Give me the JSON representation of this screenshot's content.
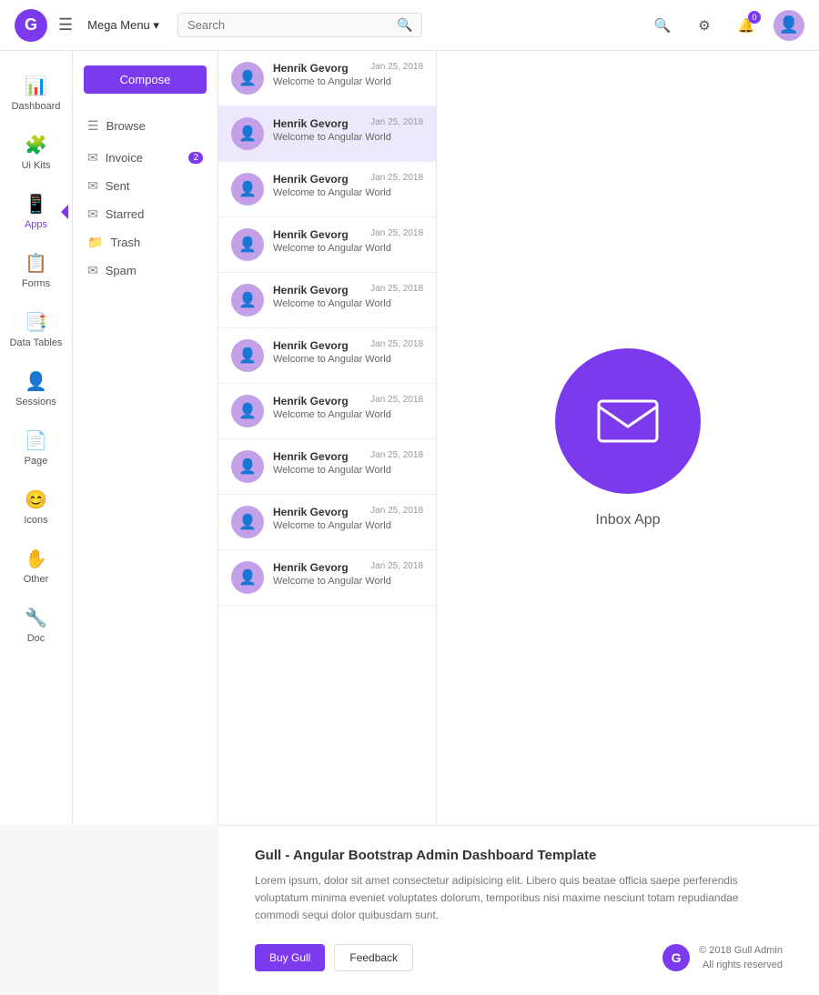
{
  "navbar": {
    "logo": "G",
    "menu_icon": "☰",
    "mega_menu_label": "Mega Menu ▾",
    "search_placeholder": "Search",
    "search_icon": "🔍",
    "icons": {
      "search": "🔍",
      "settings": "⚙",
      "notifications": "🔔",
      "notification_badge": "0",
      "avatar": "👤"
    }
  },
  "sidebar": {
    "items": [
      {
        "id": "dashboard",
        "label": "Dashboard",
        "icon": "📊"
      },
      {
        "id": "ui-kits",
        "label": "Ui Kits",
        "icon": "🧩"
      },
      {
        "id": "apps",
        "label": "Apps",
        "icon": "📱",
        "active": true
      },
      {
        "id": "forms",
        "label": "Forms",
        "icon": "📋"
      },
      {
        "id": "data-tables",
        "label": "Data Tables",
        "icon": "📑"
      },
      {
        "id": "sessions",
        "label": "Sessions",
        "icon": "👤"
      },
      {
        "id": "page",
        "label": "Page",
        "icon": "📄"
      },
      {
        "id": "icons",
        "label": "Icons",
        "icon": "😊"
      },
      {
        "id": "other",
        "label": "Other",
        "icon": "✋"
      },
      {
        "id": "doc",
        "label": "Doc",
        "icon": "🔧"
      }
    ]
  },
  "second_sidebar": {
    "compose_label": "Compose",
    "browse_label": "Browse",
    "items": [
      {
        "id": "inbox",
        "label": "Invoice",
        "badge": "2",
        "icon": "✉"
      },
      {
        "id": "sent",
        "label": "Sent",
        "icon": "✉"
      },
      {
        "id": "starred",
        "label": "Starred",
        "icon": "✉"
      },
      {
        "id": "trash",
        "label": "Trash",
        "icon": "📁"
      },
      {
        "id": "spam",
        "label": "Spam",
        "icon": "✉"
      }
    ]
  },
  "emails": [
    {
      "sender": "Henrik Gevorg",
      "date": "Jan 25, 2018",
      "subject": "Welcome to Angular World",
      "active": false
    },
    {
      "sender": "Henrik Gevorg",
      "date": "Jan 25, 2018",
      "subject": "Welcome to Angular World",
      "active": true
    },
    {
      "sender": "Henrik Gevorg",
      "date": "Jan 25, 2018",
      "subject": "Welcome to Angular World",
      "active": false
    },
    {
      "sender": "Henrik Gevorg",
      "date": "Jan 25, 2018",
      "subject": "Welcome to Angular World",
      "active": false
    },
    {
      "sender": "Henrik Gevorg",
      "date": "Jan 25, 2018",
      "subject": "Welcome to Angular World",
      "active": false
    },
    {
      "sender": "Henrik Gevorg",
      "date": "Jan 25, 2018",
      "subject": "Welcome to Angular World",
      "active": false
    },
    {
      "sender": "Henrik Gevorg",
      "date": "Jan 25, 2018",
      "subject": "Welcome to Angular World",
      "active": false
    },
    {
      "sender": "Henrik Gevorg",
      "date": "Jan 25, 2018",
      "subject": "Welcome to Angular World",
      "active": false
    },
    {
      "sender": "Henrik Gevorg",
      "date": "Jan 25, 2018",
      "subject": "Welcome to Angular World",
      "active": false
    },
    {
      "sender": "Henrik Gevorg",
      "date": "Jan 25, 2018",
      "subject": "Welcome to Angular World",
      "active": false
    }
  ],
  "inbox_preview": {
    "label": "Inbox App"
  },
  "footer": {
    "title": "Gull - Angular Bootstrap Admin Dashboard Template",
    "description": "Lorem ipsum, dolor sit amet consectetur adipisicing elit. Libero quis beatae officia saepe perferendis voluptatum minima eveniet voluptates dolorum, temporibus nisi maxime nesciunt totam repudiandae commodi sequi dolor quibusdam sunt.",
    "buy_label": "Buy Gull",
    "feedback_label": "Feedback",
    "brand_logo": "G",
    "brand_text_line1": "© 2018 Gull Admin",
    "brand_text_line2": "All rights reserved"
  }
}
